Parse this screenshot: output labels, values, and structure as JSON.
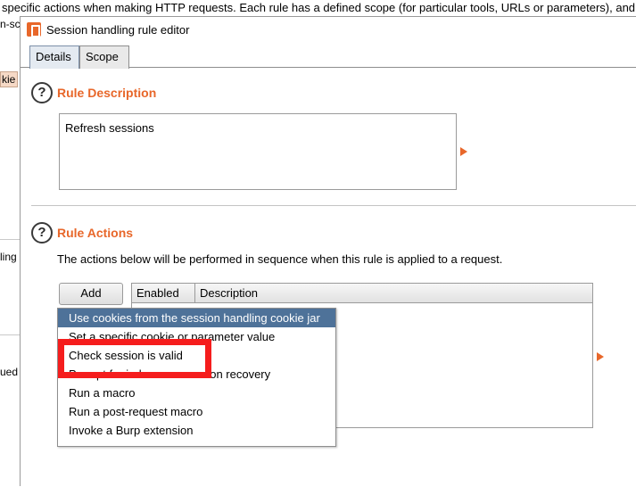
{
  "background": {
    "top_text": "specific actions when making HTTP requests. Each rule has a defined scope (for particular tools, URLs or parameters), and",
    "side_fragments": [
      "n-sc",
      "kie",
      "ling",
      "ued"
    ]
  },
  "dialog": {
    "title": "Session handling rule editor",
    "tabs": [
      "Details",
      "Scope"
    ],
    "rule_description": {
      "heading": "Rule Description",
      "value": "Refresh sessions"
    },
    "rule_actions": {
      "heading": "Rule Actions",
      "description": "The actions below will be performed in sequence when this rule is applied to a request.",
      "add_label": "Add",
      "columns": [
        "Enabled",
        "Description"
      ]
    },
    "add_menu": {
      "items": [
        "Use cookies from the session handling cookie jar",
        "Set a specific cookie or parameter value",
        "Check session is valid",
        "Prompt for in-browser session recovery",
        "Run a macro",
        "Run a post-request macro",
        "Invoke a Burp extension"
      ],
      "selected_index": 0,
      "highlighted_index": 2
    }
  },
  "colors": {
    "accent": "#e8672a",
    "selection": "#4e7299",
    "highlight": "#f51d1d"
  }
}
